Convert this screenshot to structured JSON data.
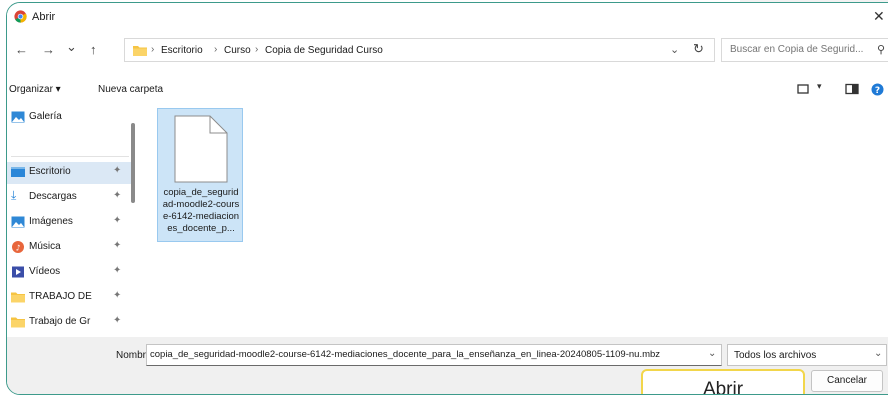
{
  "window": {
    "title": "Abrir",
    "close_glyph": "✕",
    "app_icon": "chrome-icon"
  },
  "nav_buttons": {
    "back": "←",
    "forward": "→",
    "recent": "⌄",
    "up": "↑"
  },
  "address": {
    "crumbs": [
      "Escritorio",
      "Curso",
      "Copia de Seguridad Curso"
    ],
    "separator": "›"
  },
  "search": {
    "placeholder": "Buscar en Copia de Segurid..."
  },
  "toolbar": {
    "organize": "Organizar ▾",
    "new_folder": "Nueva carpeta"
  },
  "sidebar": {
    "items": [
      {
        "label": "Galería",
        "icon": "gallery-icon",
        "pinned": false
      },
      {
        "label": "Escritorio",
        "icon": "desktop-icon",
        "pinned": true
      },
      {
        "label": "Descargas",
        "icon": "download-icon",
        "pinned": true
      },
      {
        "label": "Imágenes",
        "icon": "pictures-icon",
        "pinned": true
      },
      {
        "label": "Música",
        "icon": "music-icon",
        "pinned": true
      },
      {
        "label": "Vídeos",
        "icon": "videos-icon",
        "pinned": true
      },
      {
        "label": "TRABAJO DE",
        "icon": "folder-icon",
        "pinned": true
      },
      {
        "label": "Trabajo de Gr",
        "icon": "folder-icon",
        "pinned": true
      }
    ],
    "pin_glyph": "✦"
  },
  "files": [
    {
      "name": "copia_de_seguridad-moodle2-course-6142-mediaciones_docente_p...",
      "selected": true
    }
  ],
  "footer": {
    "name_label": "Nombre:",
    "name_value": "copia_de_seguridad-moodle2-course-6142-mediaciones_docente_para_la_enseñanza_en_linea-20240805-1109-nu.mbz",
    "file_type": "Todos los archivos",
    "open_button": "Abrir",
    "cancel_button": "Cancelar"
  },
  "colors": {
    "accent_frame": "#3d9a8b",
    "selection": "#cce4f7",
    "open_highlight": "#f2d64b",
    "folder": "#f6c443"
  }
}
